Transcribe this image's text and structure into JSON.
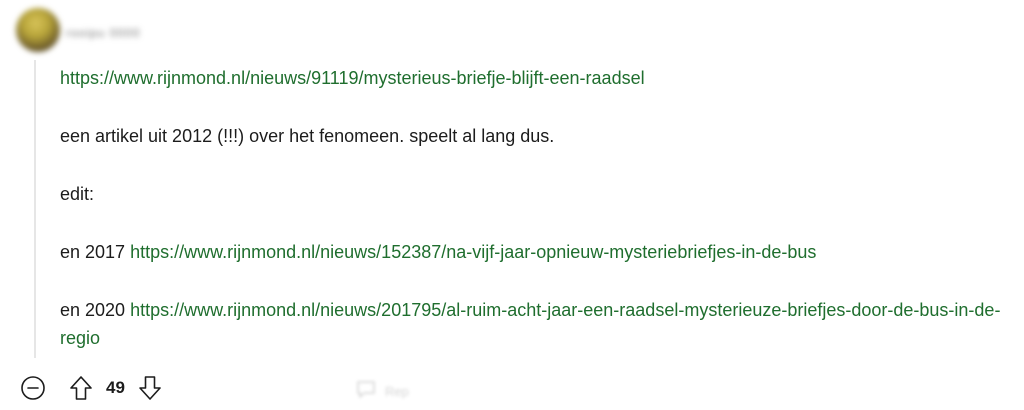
{
  "comment": {
    "username": "rooipu 0000",
    "paragraphs": [
      {
        "parts": [
          {
            "type": "link",
            "text": "https://www.rijnmond.nl/nieuws/91119/mysterieus-briefje-blijft-een-raadsel"
          }
        ]
      },
      {
        "parts": [
          {
            "type": "text",
            "text": "een artikel uit 2012 (!!!) over het fenomeen. speelt al lang dus."
          }
        ]
      },
      {
        "parts": [
          {
            "type": "text",
            "text": "edit:"
          }
        ]
      },
      {
        "parts": [
          {
            "type": "text",
            "text": "en 2017 "
          },
          {
            "type": "link",
            "text": "https://www.rijnmond.nl/nieuws/152387/na-vijf-jaar-opnieuw-mysteriebriefjes-in-de-bus"
          }
        ]
      },
      {
        "parts": [
          {
            "type": "text",
            "text": "en 2020 "
          },
          {
            "type": "link",
            "text": "https://www.rijnmond.nl/nieuws/201795/al-ruim-acht-jaar-een-raadsel-mysterieuze-briefjes-door-de-bus-in-de-regio"
          }
        ]
      }
    ],
    "actions": {
      "score": "49",
      "collapse_icon": "minus-circle-icon",
      "upvote_icon": "arrow-up-icon",
      "downvote_icon": "arrow-down-icon",
      "reply_icon": "speech-bubble-icon",
      "reply_label": "Rep"
    },
    "colors": {
      "link": "#1f6e2e",
      "text": "#1c1c1c",
      "thread_line": "#e6e6e6"
    }
  }
}
